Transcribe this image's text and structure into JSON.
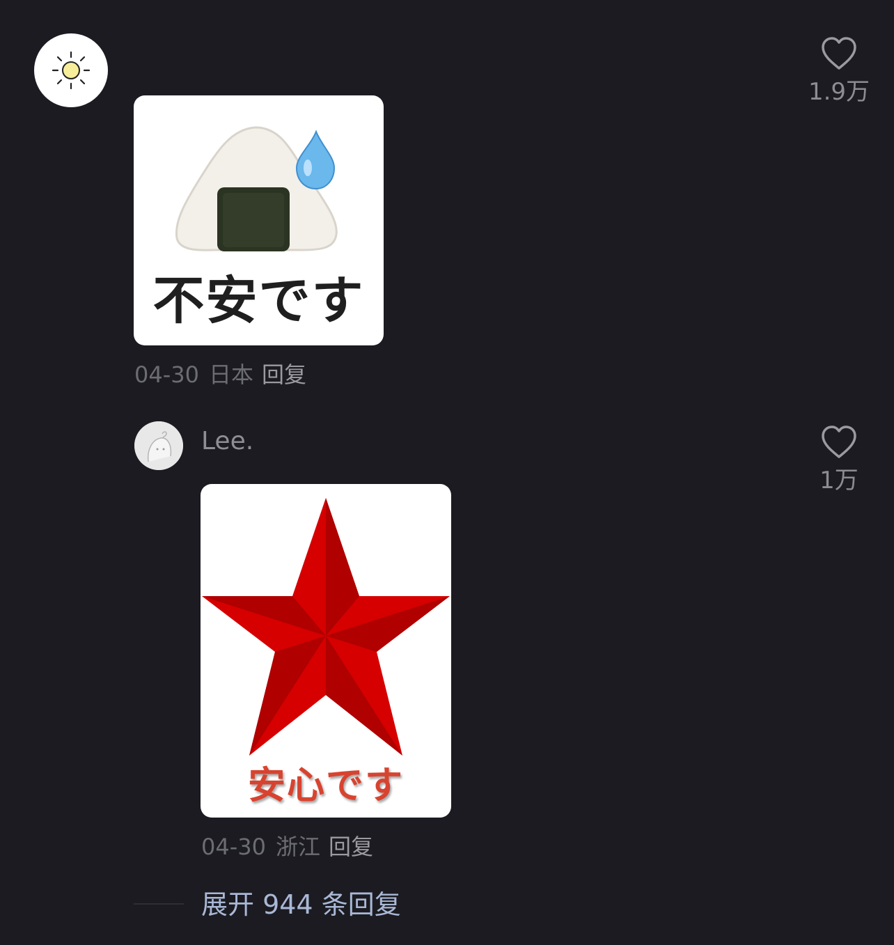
{
  "comment1": {
    "username": "",
    "sticker_text": "不安です",
    "date": "04-30",
    "location": "日本",
    "reply_label": "回复",
    "likes": "1.9万"
  },
  "comment2": {
    "username": "Lee.",
    "sticker_text": "安心です",
    "date": "04-30",
    "location": "浙江",
    "reply_label": "回复",
    "likes": "1万"
  },
  "expand_replies": "展开 944 条回复",
  "colors": {
    "background": "#1b1b21",
    "meta_text": "#6c6c73",
    "link_text": "#a9b8d6",
    "star_red": "#d60000"
  }
}
